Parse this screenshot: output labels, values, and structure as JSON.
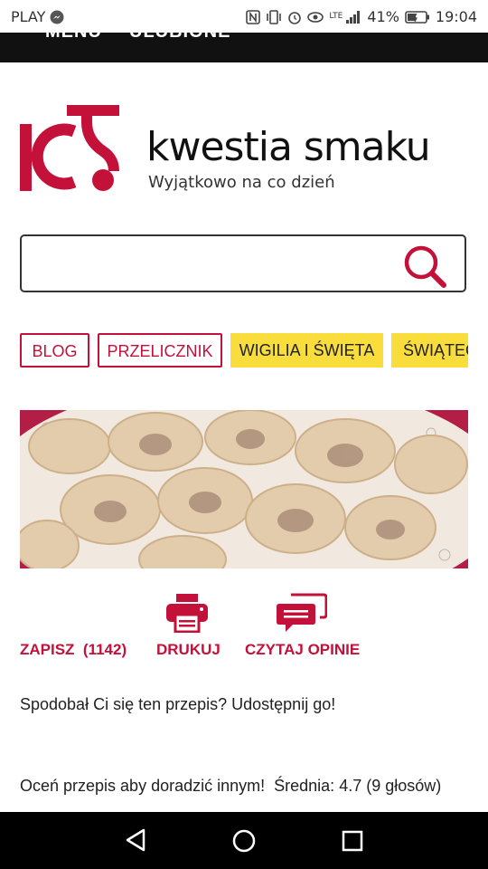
{
  "status_bar": {
    "carrier": "PLAY",
    "network_label": "LTE",
    "battery": "41%",
    "time": "19:04"
  },
  "top_nav": {
    "items": [
      "MENU",
      "ULUBIONE"
    ]
  },
  "brand": {
    "name": "kwestia smaku",
    "tagline": "Wyjątkowo na co dzień",
    "color": "#c4113a"
  },
  "search": {
    "value": "",
    "placeholder": ""
  },
  "tags": [
    {
      "label": "BLOG"
    },
    {
      "label": "PRZELICZNIK"
    },
    {
      "label": "WIGILIA I ŚWIĘTA"
    },
    {
      "label": "ŚWIĄTEC"
    }
  ],
  "actions": {
    "save_label": "ZAPISZ",
    "save_count": "(1142)",
    "print_label": "DRUKUJ",
    "reviews_label": "CZYTAJ OPINIE"
  },
  "share_prompt": "Spodobał Ci się ten przepis? Udostępnij go!",
  "rating": {
    "prompt": "Oceń przepis aby doradzić innym!",
    "average_label": "Średnia:",
    "average": "4.7",
    "votes": "(9 głosów)"
  },
  "icons": {
    "search": "search-icon",
    "print": "printer-icon",
    "reviews": "comments-icon",
    "back": "back-icon",
    "home": "home-icon",
    "recents": "recents-icon"
  }
}
